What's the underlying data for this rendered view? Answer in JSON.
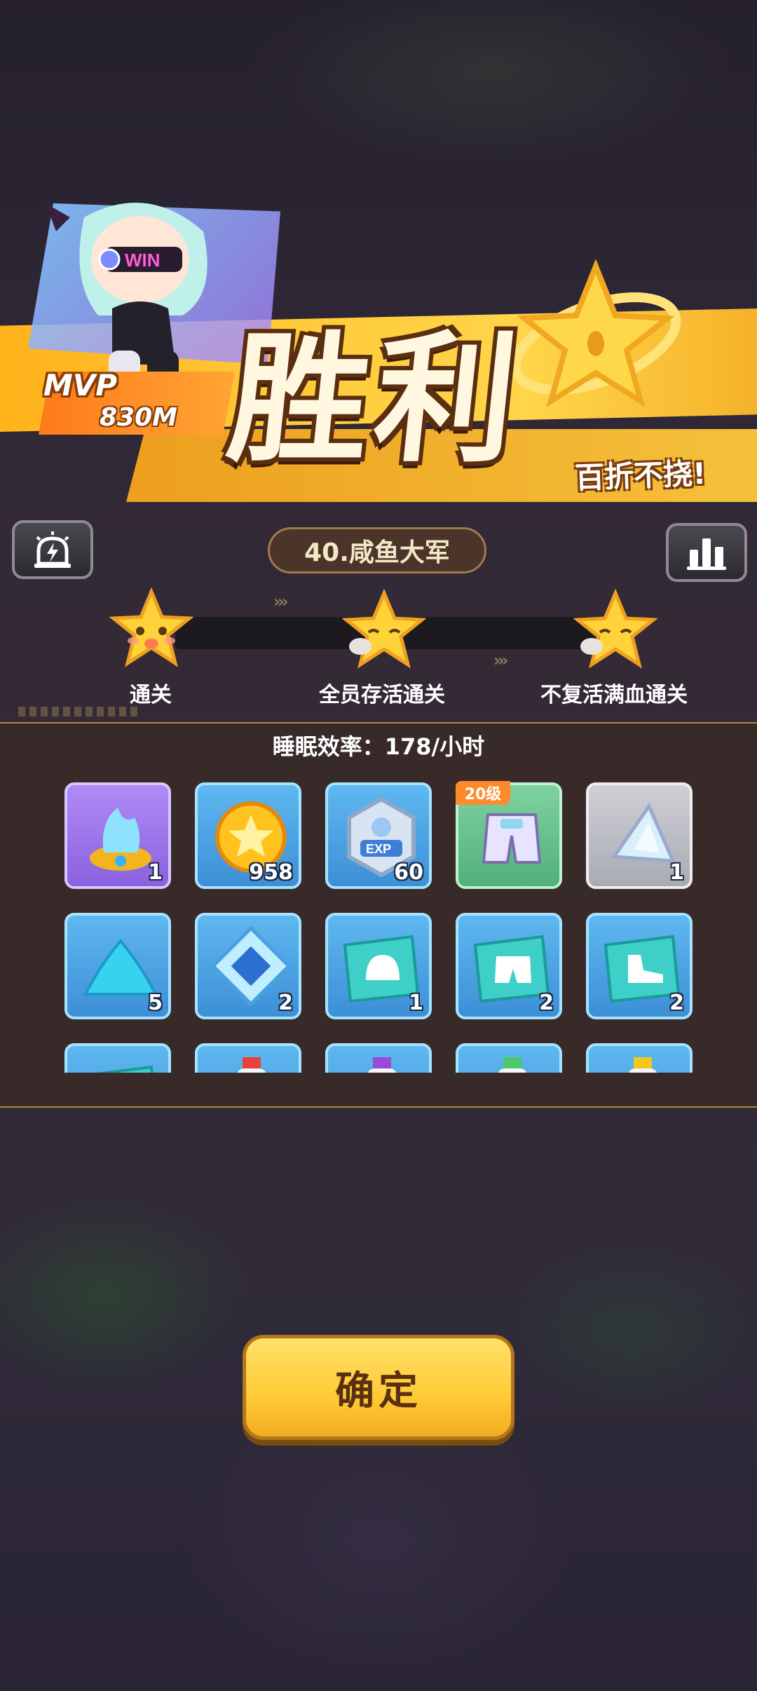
{
  "header": {
    "title": "胜利",
    "subtitle": "百折不挠!",
    "mvp": {
      "label": "MVP",
      "value": "830M"
    },
    "mascot_text": "WIN"
  },
  "stage": {
    "name": "40.咸鱼大军"
  },
  "controls": {
    "alert_icon": "alarm-bolt-icon",
    "stats_icon": "bar-chart-icon"
  },
  "objectives": [
    {
      "label": "通关",
      "achieved": true
    },
    {
      "label": "全员存活通关",
      "achieved": false
    },
    {
      "label": "不复活满血通关",
      "achieved": false
    }
  ],
  "rewards": {
    "sleep_rate": "睡眠效率：178/小时",
    "items": [
      {
        "icon": "blue-flame-core-icon",
        "qty": "1",
        "bg": "purple"
      },
      {
        "icon": "gold-coin-icon",
        "qty": "958",
        "bg": "blue"
      },
      {
        "icon": "exp-badge-icon",
        "qty": "60",
        "bg": "blue"
      },
      {
        "icon": "shorts-gear-icon",
        "qty": "",
        "bg": "green",
        "level_tag": "20级"
      },
      {
        "icon": "crystal-shard-icon",
        "qty": "1",
        "bg": "grey"
      },
      {
        "icon": "blue-powder-icon",
        "qty": "5",
        "bg": "blue"
      },
      {
        "icon": "blue-gem-icon",
        "qty": "2",
        "bg": "blue"
      },
      {
        "icon": "helmet-blueprint-icon",
        "qty": "1",
        "bg": "blue"
      },
      {
        "icon": "shorts-blueprint-icon",
        "qty": "2",
        "bg": "blue"
      },
      {
        "icon": "shoe-blueprint-icon",
        "qty": "2",
        "bg": "blue"
      },
      {
        "icon": "blueprint-icon",
        "qty": "",
        "bg": "blue"
      },
      {
        "icon": "red-potion-icon",
        "qty": "",
        "bg": "blue"
      },
      {
        "icon": "purple-potion-icon",
        "qty": "",
        "bg": "blue"
      },
      {
        "icon": "green-potion-icon",
        "qty": "",
        "bg": "blue"
      },
      {
        "icon": "yellow-potion-icon",
        "qty": "",
        "bg": "blue"
      }
    ]
  },
  "footer": {
    "confirm_label": "确定"
  },
  "colors": {
    "accent": "#ffc935",
    "panel": "#372a28",
    "item_blue": "#5fb8f0"
  }
}
